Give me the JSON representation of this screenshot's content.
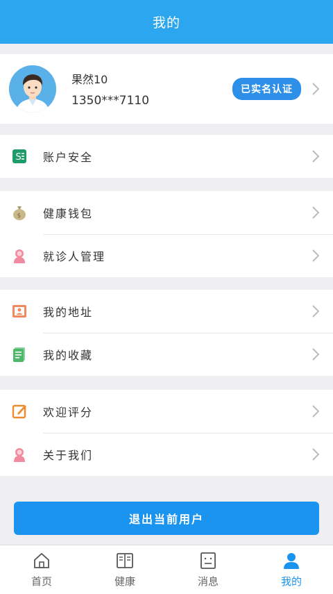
{
  "header": {
    "title": "我的"
  },
  "profile": {
    "name": "果然10",
    "phone": "1350***7110",
    "verified_badge": "已实名认证"
  },
  "menu_groups": [
    {
      "items": [
        {
          "label": "账户安全",
          "icon": "account-security-icon"
        }
      ]
    },
    {
      "items": [
        {
          "label": "健康钱包",
          "icon": "money-bag-icon"
        },
        {
          "label": "就诊人管理",
          "icon": "patient-icon"
        }
      ]
    },
    {
      "items": [
        {
          "label": "我的地址",
          "icon": "address-card-icon"
        },
        {
          "label": "我的收藏",
          "icon": "favorites-icon"
        }
      ]
    },
    {
      "items": [
        {
          "label": "欢迎评分",
          "icon": "edit-rating-icon"
        },
        {
          "label": "关于我们",
          "icon": "about-us-icon"
        }
      ]
    }
  ],
  "logout": {
    "label": "退出当前用户"
  },
  "tabbar": {
    "tabs": [
      {
        "label": "首页",
        "icon": "home-icon"
      },
      {
        "label": "健康",
        "icon": "book-icon"
      },
      {
        "label": "消息",
        "icon": "message-icon"
      },
      {
        "label": "我的",
        "icon": "user-icon",
        "active": true
      }
    ]
  },
  "colors": {
    "primary": "#2ca6ee",
    "button": "#1b94ef",
    "background": "#eeeef3"
  }
}
